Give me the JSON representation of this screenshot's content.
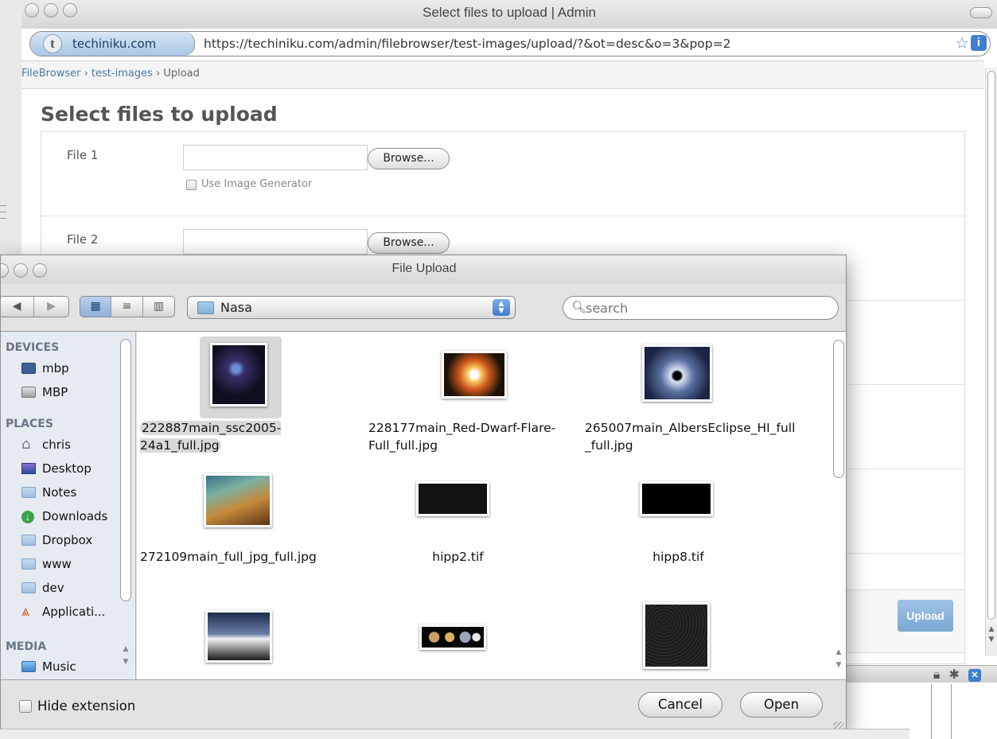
{
  "browser": {
    "title": "Select files to upload | Admin",
    "site_name": "techiniku.com",
    "site_favicon": "t",
    "url": "https://techiniku.com/admin/filebrowser/test-images/upload/?&ot=desc&o=3&pop=2"
  },
  "breadcrumb": {
    "items": [
      "FileBrowser",
      "test-images",
      "Upload"
    ],
    "separator": "›"
  },
  "page": {
    "title": "Select files to upload",
    "browse_label": "Browse...",
    "image_generator_label": "Use Image Generator",
    "upload_label": "Upload",
    "file_rows": [
      {
        "label": "File 1"
      },
      {
        "label": "File 2"
      }
    ]
  },
  "dialog": {
    "title": "File Upload",
    "location": "Nasa",
    "search_placeholder": "search",
    "hide_extension_label": "Hide extension",
    "cancel_label": "Cancel",
    "open_label": "Open",
    "sidebar": {
      "devices_header": "DEVICES",
      "devices": [
        "mbp",
        "MBP"
      ],
      "places_header": "PLACES",
      "places": [
        "chris",
        "Desktop",
        "Notes",
        "Downloads",
        "Dropbox",
        "www",
        "dev",
        "Applicati..."
      ],
      "media_header": "MEDIA",
      "media": [
        "Music"
      ]
    },
    "files": [
      {
        "name": "222887main_ssc2005-24a1_full.jpg",
        "selected": true
      },
      {
        "name": "228177main_Red-Dwarf-Flare-Full_full.jpg",
        "selected": false
      },
      {
        "name": "265007main_AlbersEclipse_HI_full_full.jpg",
        "selected": false
      },
      {
        "name": "272109main_full_jpg_full.jpg",
        "selected": false
      },
      {
        "name": "hipp2.tif",
        "selected": false
      },
      {
        "name": "hipp8.tif",
        "selected": false
      }
    ]
  },
  "colors": {
    "accent": "#3f7fcf",
    "upload_button": "#8fb5dc",
    "sidebar_bg": "#e6ebf1",
    "selection": "#d9d9d9"
  },
  "icons": {
    "star": "bookmark-star-icon",
    "info": "info-icon",
    "search": "magnifier-icon"
  }
}
